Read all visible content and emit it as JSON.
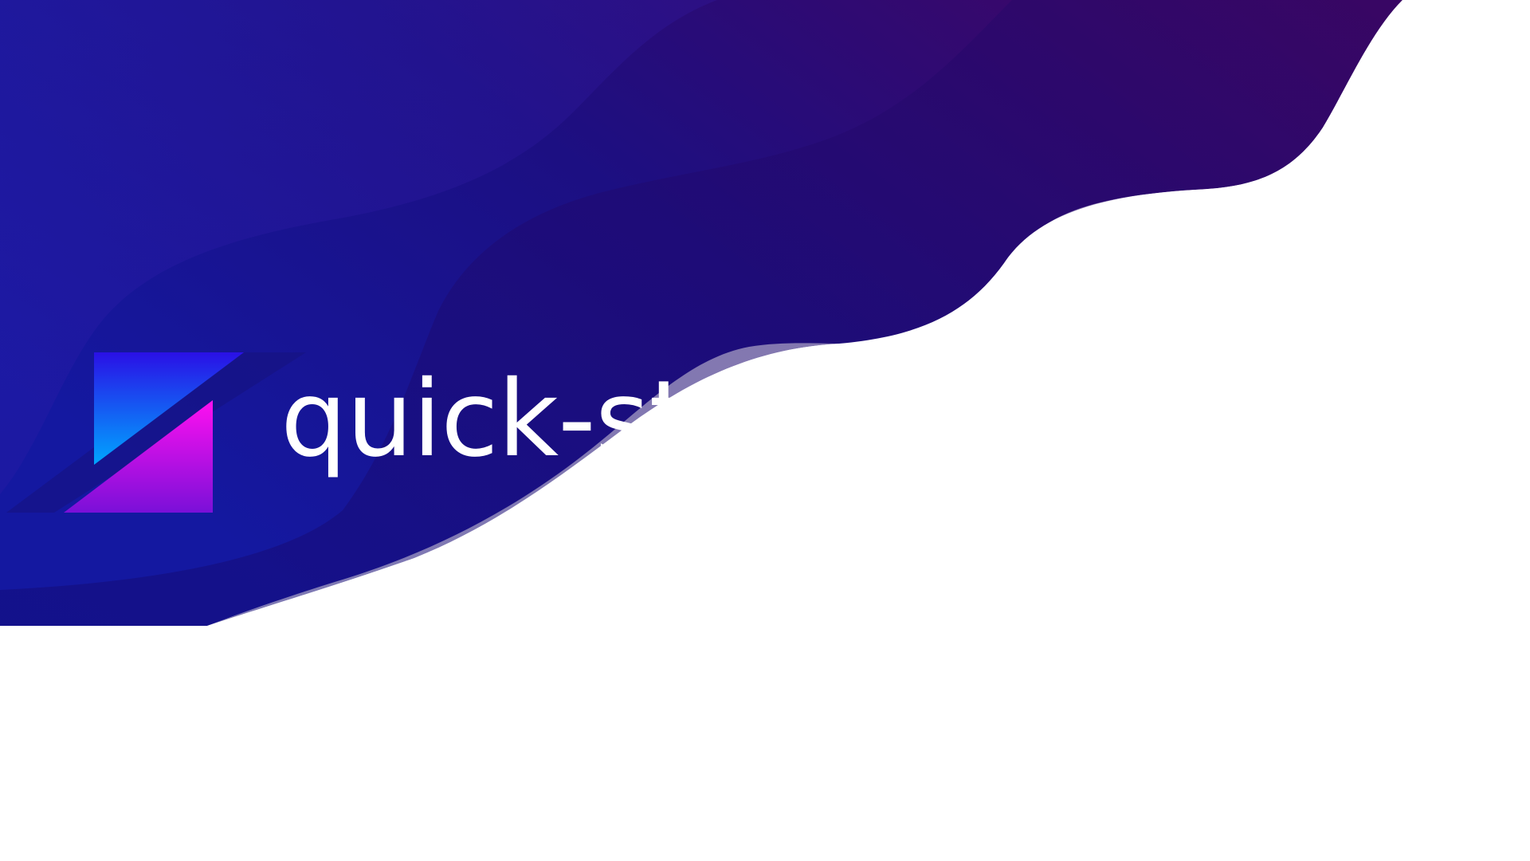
{
  "brand": {
    "name": "quick-st"
  },
  "colors": {
    "background": "#ffffff",
    "gradient_blue": "#1a1aa0",
    "gradient_indigo": "#1c0f7e",
    "gradient_purple": "#3a0a6e",
    "gradient_magenta": "#4a0560",
    "logo_blue_top": "#2a10e6",
    "logo_cyan_bottom": "#00a6ff",
    "logo_magenta_top": "#ff10f0",
    "logo_purple_bottom": "#7a10d8",
    "text": "#ffffff"
  },
  "icons": {
    "logo": "split-square-logo-icon"
  }
}
